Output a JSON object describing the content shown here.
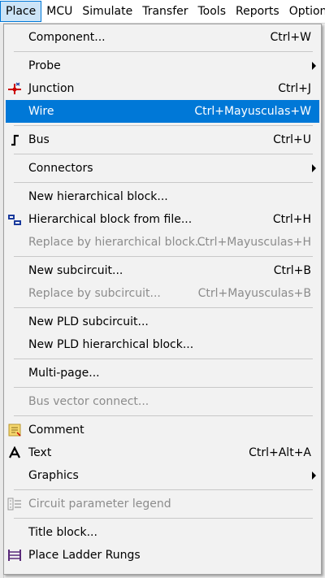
{
  "menubar": {
    "items": [
      "Place",
      "MCU",
      "Simulate",
      "Transfer",
      "Tools",
      "Reports",
      "Options"
    ]
  },
  "colors": {
    "highlight": "#0078d7",
    "menu_bg": "#f2f2f2",
    "disabled_text": "#8c8c8c"
  },
  "menu": {
    "items": [
      {
        "label": "Component...",
        "shortcut": "Ctrl+W",
        "icon": ""
      },
      {
        "label": "Probe",
        "shortcut": "",
        "icon": "",
        "submenu": true
      },
      {
        "label": "Junction",
        "shortcut": "Ctrl+J",
        "icon": "junction-icon"
      },
      {
        "label": "Wire",
        "shortcut": "Ctrl+Mayusculas+W",
        "icon": "",
        "highlighted": true
      },
      {
        "label": "Bus",
        "shortcut": "Ctrl+U",
        "icon": "bus-icon"
      },
      {
        "label": "Connectors",
        "shortcut": "",
        "icon": "",
        "submenu": true
      },
      {
        "label": "New hierarchical block...",
        "shortcut": "",
        "icon": ""
      },
      {
        "label": "Hierarchical block from file...",
        "shortcut": "Ctrl+H",
        "icon": "hierarchical-block-icon"
      },
      {
        "label": "Replace by hierarchical block...",
        "shortcut": "Ctrl+Mayusculas+H",
        "icon": "",
        "disabled": true
      },
      {
        "label": "New subcircuit...",
        "shortcut": "Ctrl+B",
        "icon": ""
      },
      {
        "label": "Replace by subcircuit...",
        "shortcut": "Ctrl+Mayusculas+B",
        "icon": "",
        "disabled": true
      },
      {
        "label": "New PLD subcircuit...",
        "shortcut": "",
        "icon": ""
      },
      {
        "label": "New PLD hierarchical block...",
        "shortcut": "",
        "icon": ""
      },
      {
        "label": "Multi-page...",
        "shortcut": "",
        "icon": ""
      },
      {
        "label": "Bus vector connect...",
        "shortcut": "",
        "icon": "",
        "disabled": true
      },
      {
        "label": "Comment",
        "shortcut": "",
        "icon": "comment-icon"
      },
      {
        "label": "Text",
        "shortcut": "Ctrl+Alt+A",
        "icon": "text-icon"
      },
      {
        "label": "Graphics",
        "shortcut": "",
        "icon": "",
        "submenu": true
      },
      {
        "label": "Circuit parameter legend",
        "shortcut": "",
        "icon": "parameter-legend-icon",
        "disabled": true
      },
      {
        "label": "Title block...",
        "shortcut": "",
        "icon": ""
      },
      {
        "label": "Place Ladder Rungs",
        "shortcut": "",
        "icon": "ladder-rungs-icon"
      }
    ]
  }
}
